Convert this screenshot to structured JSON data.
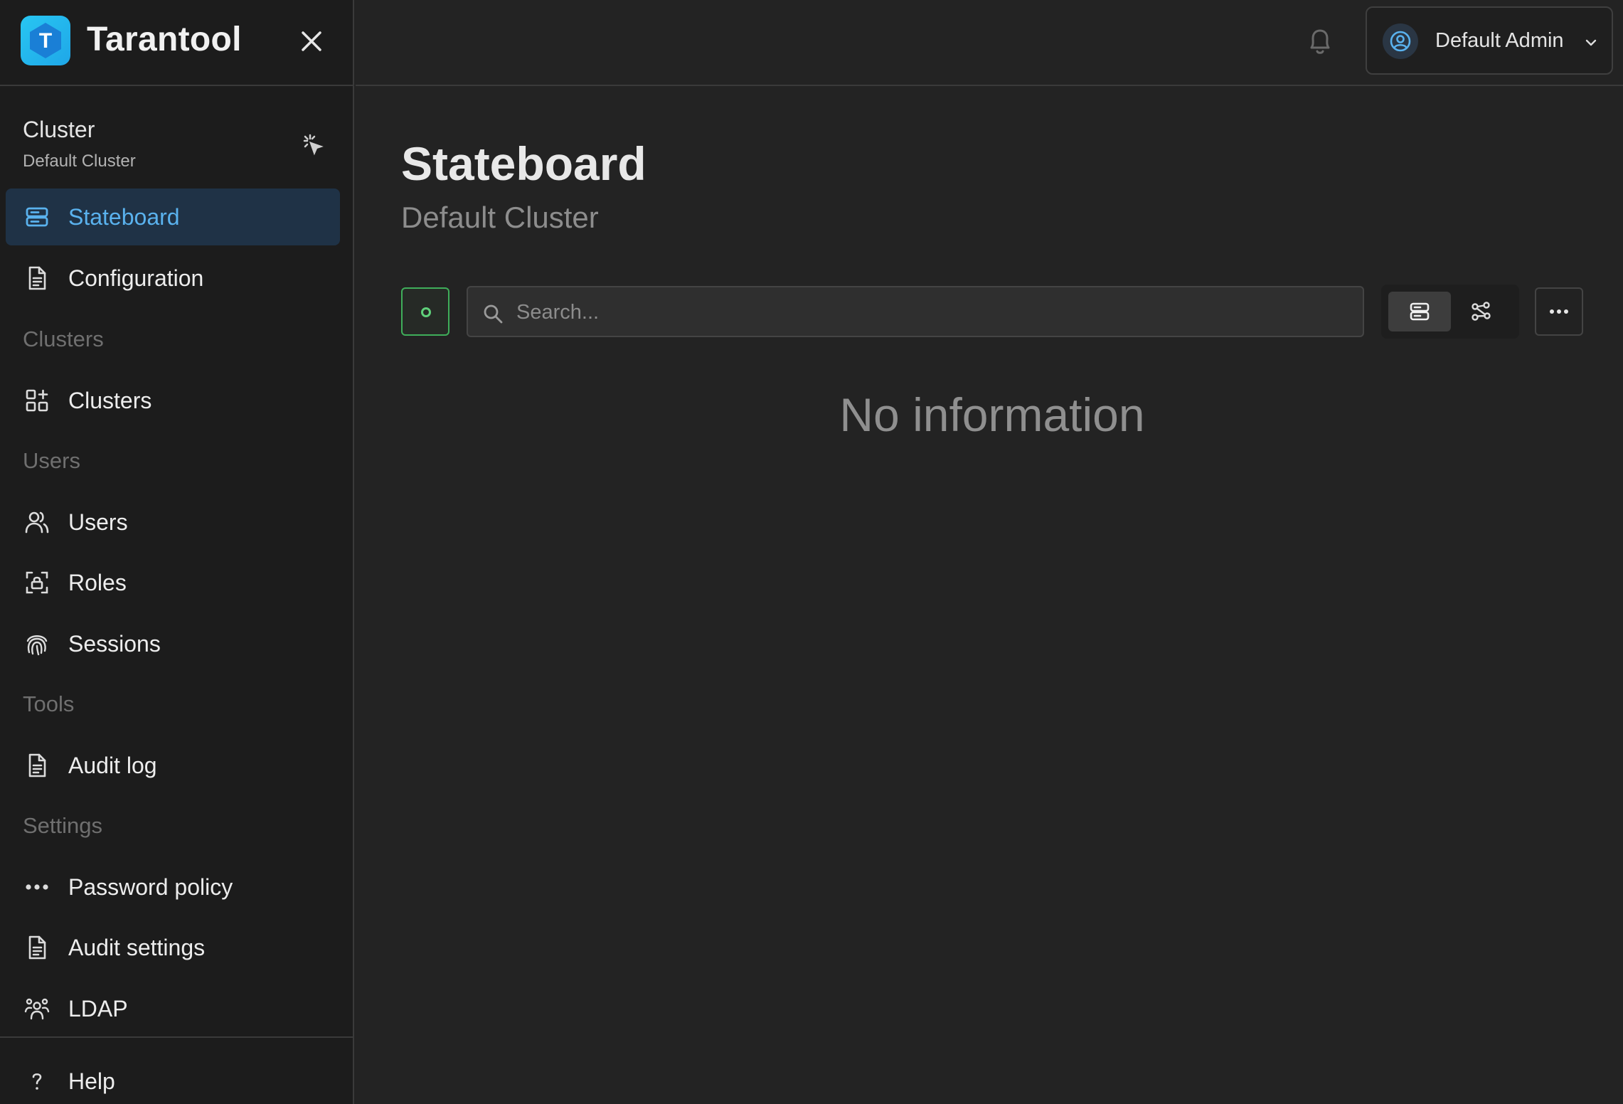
{
  "brand": {
    "name": "Tarantool",
    "logo_letter": "T",
    "accent": "#28c6f2"
  },
  "cluster": {
    "title": "Cluster",
    "name": "Default Cluster"
  },
  "sidebar": {
    "items": [
      {
        "label": "Stateboard",
        "icon": "server-icon",
        "active": true
      },
      {
        "label": "Configuration",
        "icon": "document-icon"
      }
    ],
    "sections": [
      {
        "title": "Clusters",
        "items": [
          {
            "label": "Clusters",
            "icon": "grid-add-icon"
          }
        ]
      },
      {
        "title": "Users",
        "items": [
          {
            "label": "Users",
            "icon": "users-icon"
          },
          {
            "label": "Roles",
            "icon": "lock-scan-icon"
          },
          {
            "label": "Sessions",
            "icon": "fingerprint-icon"
          }
        ]
      },
      {
        "title": "Tools",
        "items": [
          {
            "label": "Audit log",
            "icon": "document-icon"
          }
        ]
      },
      {
        "title": "Settings",
        "items": [
          {
            "label": "Password policy",
            "icon": "password-dots-icon"
          },
          {
            "label": "Audit settings",
            "icon": "document-icon"
          },
          {
            "label": "LDAP",
            "icon": "group-icon"
          }
        ]
      }
    ],
    "help": {
      "label": "Help",
      "icon": "question-icon"
    }
  },
  "header": {
    "user_name": "Default Admin"
  },
  "main": {
    "title": "Stateboard",
    "subtitle": "Default Cluster",
    "search_placeholder": "Search...",
    "empty_text": "No information"
  },
  "colors": {
    "active_text": "#5ab2ee",
    "active_bg": "#1f3246",
    "status_green": "#5fd07a"
  }
}
